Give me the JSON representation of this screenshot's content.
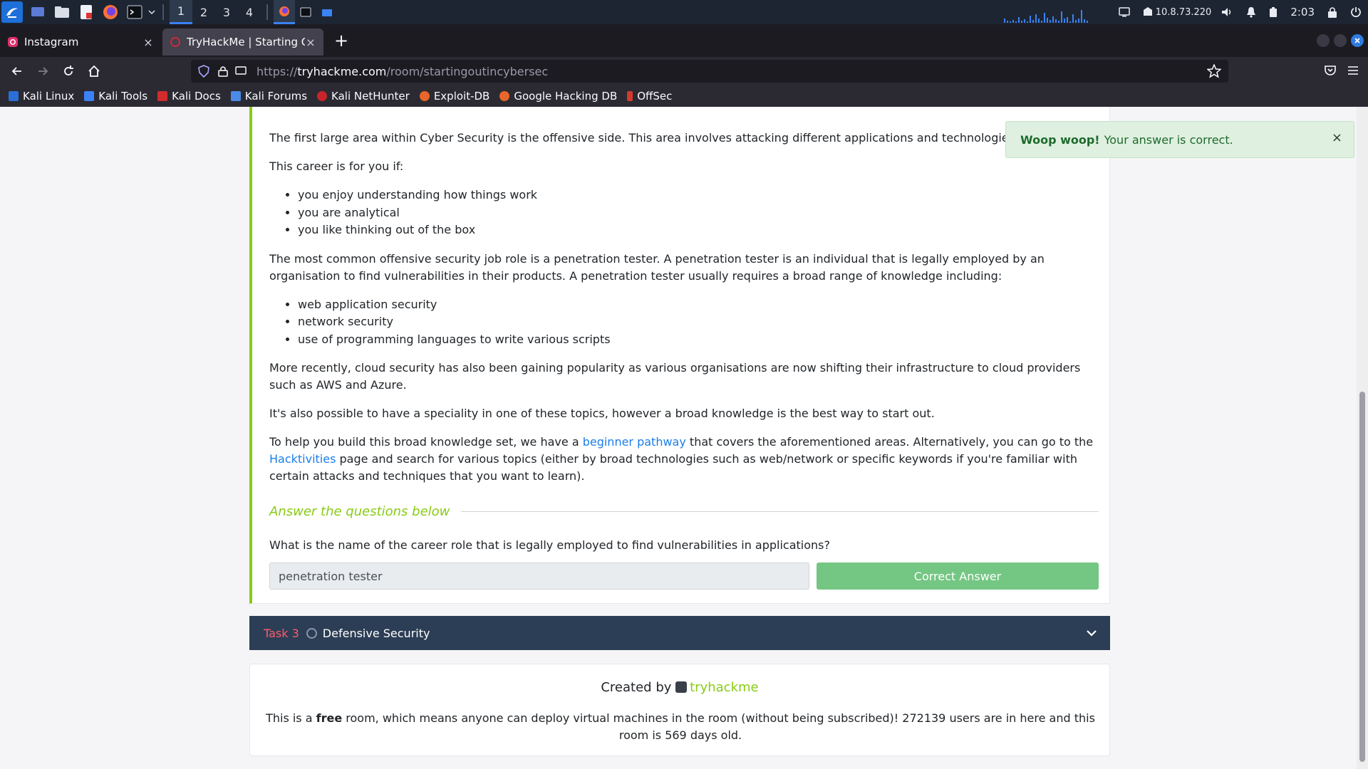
{
  "panel": {
    "workspaces": [
      "1",
      "2",
      "3",
      "4"
    ],
    "active_workspace": "1",
    "ip": "10.8.73.220",
    "clock": "2:03",
    "icons": [
      "kali-menu-icon",
      "desktop-icon",
      "file-manager-icon",
      "text-editor-icon",
      "firefox-icon",
      "terminal-icon",
      "dropdown-icon"
    ]
  },
  "tabs": [
    {
      "title": "Instagram",
      "close": "×"
    },
    {
      "title": "TryHackMe | Starting Out",
      "close": "×"
    }
  ],
  "new_tab": "+",
  "url": {
    "protocol": "https://",
    "host": "tryhackme.com",
    "path": "/room/startingoutincybersec"
  },
  "bookmarks": [
    "Kali Linux",
    "Kali Tools",
    "Kali Docs",
    "Kali Forums",
    "Kali NetHunter",
    "Exploit-DB",
    "Google Hacking DB",
    "OffSec"
  ],
  "content": {
    "p1": "The first large area within Cyber Security is the offensive side. This area involves attacking different applications and technologies to discover vu",
    "p2": "This career is for you if:",
    "list1": [
      "you enjoy understanding how things work",
      "you are analytical",
      "you like thinking out of the box"
    ],
    "p3": "The most common offensive security job role is a penetration tester. A penetration tester is an individual that is legally employed by an organisation to find vulnerabilities in their products. A penetration tester usually requires a broad range of knowledge including:",
    "list2": [
      "web application security",
      "network security",
      "use of programming languages to write various scripts"
    ],
    "p4": "More recently, cloud security has also been gaining popularity as various organisations are now shifting their infrastructure to cloud providers such as AWS and Azure.",
    "p5": "It's also possible to have a speciality in one of these topics, however a broad knowledge is the best way to start out.",
    "p6_a": "To help you build this broad knowledge set, we have a ",
    "p6_link1": "beginner pathway",
    "p6_b": " that covers the aforementioned areas. Alternatively, you can go to the ",
    "p6_link2": "Hacktivities",
    "p6_c": " page and search for various topics (either by broad technologies such as web/network or specific keywords if you're familiar with certain attacks and techniques that you want to learn)."
  },
  "questions": {
    "heading": "Answer the questions below",
    "q1": "What is the name of the career role that is legally employed to find vulnerabilities in applications?",
    "answer": "penetration tester",
    "button": "Correct Answer"
  },
  "task3": {
    "number": "Task 3",
    "title": "Defensive Security"
  },
  "footer": {
    "created_by": "Created by",
    "author": "tryhackme",
    "info_a": "This is a ",
    "info_free": "free",
    "info_b": " room, which means anyone can deploy virtual machines in the room (without being subscribed)! 272139 users are in here and this room is 569 days old."
  },
  "toast": {
    "strong": "Woop woop!",
    "text": "Your answer is correct.",
    "close": "×"
  },
  "colors": {
    "thm_green": "#88cc14",
    "task_bar": "#2c3e55",
    "task_red": "#ff5c6c",
    "link_blue": "#1b7ee8",
    "correct_button": "#74c683"
  }
}
